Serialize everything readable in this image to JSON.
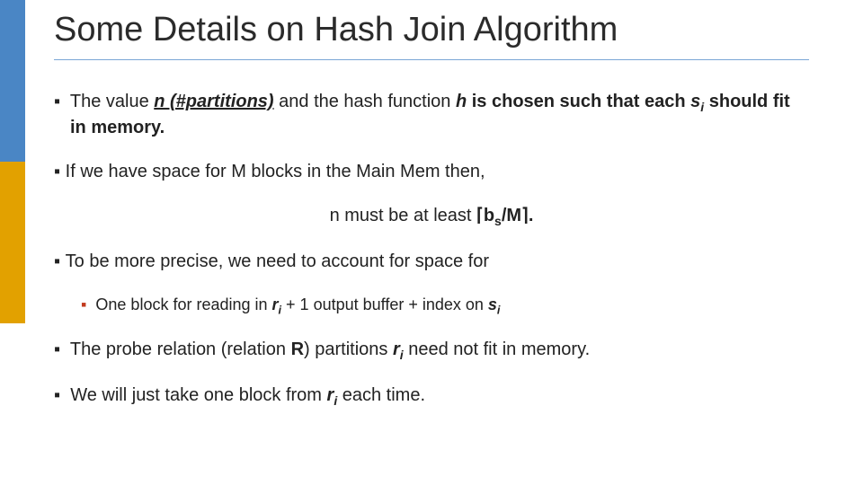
{
  "title": "Some Details on Hash Join Algorithm",
  "p1": {
    "a": "The value ",
    "n": "n (#partitions)",
    "b": " and the hash function ",
    "h": "h",
    "c": " is chosen such that each ",
    "s": "s",
    "i": "i",
    "d": "  should fit in memory."
  },
  "p2": "If we have space for M blocks in the Main Mem then,",
  "eq": {
    "a": "n must be at least ",
    "lc": "⌈",
    "b": "b",
    "s": "s",
    "m": "/M",
    "rc": "⌉",
    "dot": "."
  },
  "p3": "To be more precise, we need to account for space for",
  "p3a": {
    "a": "One block for reading in ",
    "r": "r",
    "i": "i",
    "b": " + 1 output buffer + index on ",
    "s": "s",
    "j": "i"
  },
  "p4": {
    "a": "The probe relation (relation ",
    "R": "R",
    "b": ") partitions ",
    "r": "r",
    "i": "i",
    "c": " need not fit in memory."
  },
  "p5": {
    "a": "We will just take one block from ",
    "r": "r",
    "i": "i",
    "b": "  each time."
  }
}
